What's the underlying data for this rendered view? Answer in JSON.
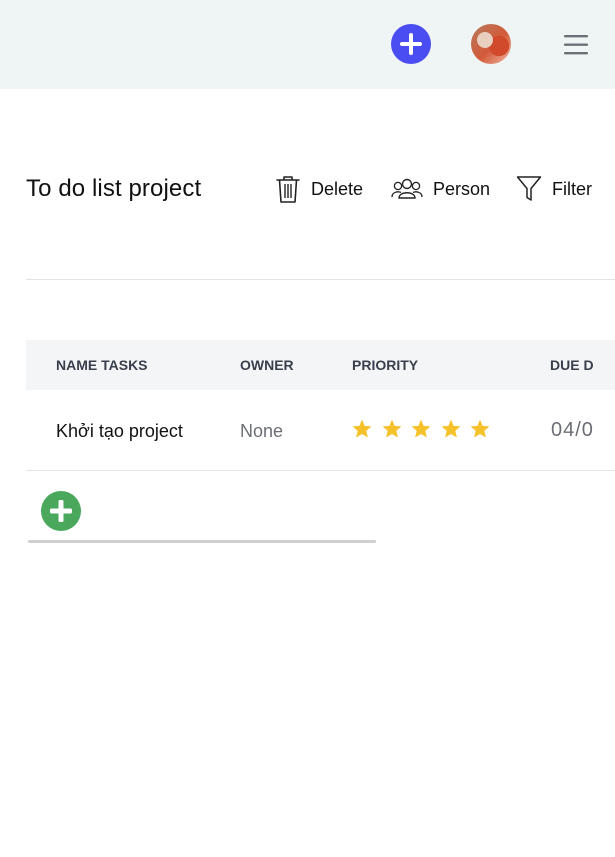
{
  "header": {
    "add_icon": "plus-circle-icon",
    "avatar_icon": "user-avatar",
    "menu_icon": "hamburger-menu-icon"
  },
  "project": {
    "title": "To do list project"
  },
  "toolbar": {
    "delete_label": "Delete",
    "person_label": "Person",
    "filter_label": "Filter"
  },
  "table": {
    "columns": [
      "NAME TASKS",
      "OWNER",
      "PRIORITY",
      "DUE D"
    ],
    "rows": [
      {
        "name": "Khởi tạo project",
        "owner": "None",
        "priority": 5,
        "due": "04/0"
      }
    ]
  },
  "colors": {
    "accent": "#4a4df1",
    "add_row": "#4aa85c",
    "star": "#f5c22b",
    "header_bg": "#eff4f4"
  }
}
